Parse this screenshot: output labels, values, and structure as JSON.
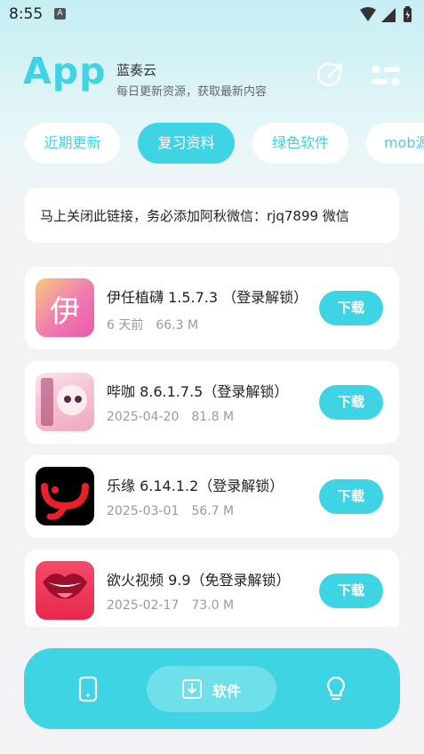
{
  "status_bar": {
    "time": "8:55",
    "notif_icon": "font-icon",
    "icons": [
      "wifi-icon",
      "signal-icon",
      "battery-icon"
    ]
  },
  "header": {
    "logo": "App",
    "title": "蓝奏云",
    "subtitle": "每日更新资源，获取最新内容",
    "share_icon": "share-icon",
    "menu_icon": "menu-toggle-icon"
  },
  "tabs": [
    {
      "label": "近期更新",
      "active": false
    },
    {
      "label": "复习资料",
      "active": true
    },
    {
      "label": "绿色软件",
      "active": false
    },
    {
      "label": "mob源",
      "active": false
    }
  ],
  "notice": {
    "text": "马上关闭此链接，务必添加阿秋微信：rjq7899 微信"
  },
  "apps": [
    {
      "title": "伊任植礴 1.5.7.3 （登录解锁）",
      "date": "6 天前",
      "size": "66.3 M",
      "button": "下载",
      "icon": "yiren-app-icon"
    },
    {
      "title": "哔咖 8.6.1.7.5（登录解锁）",
      "date": "2025-04-20",
      "size": "81.8 M",
      "button": "下载",
      "icon": "bika-app-icon"
    },
    {
      "title": "乐缘 6.14.1.2（登录解锁）",
      "date": "2025-03-01",
      "size": "56.7 M",
      "button": "下载",
      "icon": "leyuan-app-icon"
    },
    {
      "title": "欲火视频 9.9（免登录解锁）",
      "date": "2025-02-17",
      "size": "73.0 M",
      "button": "下载",
      "icon": "yuhuo-app-icon"
    }
  ],
  "bottom_nav": {
    "left_icon": "phone-icon",
    "center_icon": "download-icon",
    "center_label": "软件",
    "right_icon": "lightbulb-icon"
  },
  "colors": {
    "accent": "#3fd4e3",
    "accent_light": "#6fe0ea",
    "background": "#f3f3f5"
  }
}
